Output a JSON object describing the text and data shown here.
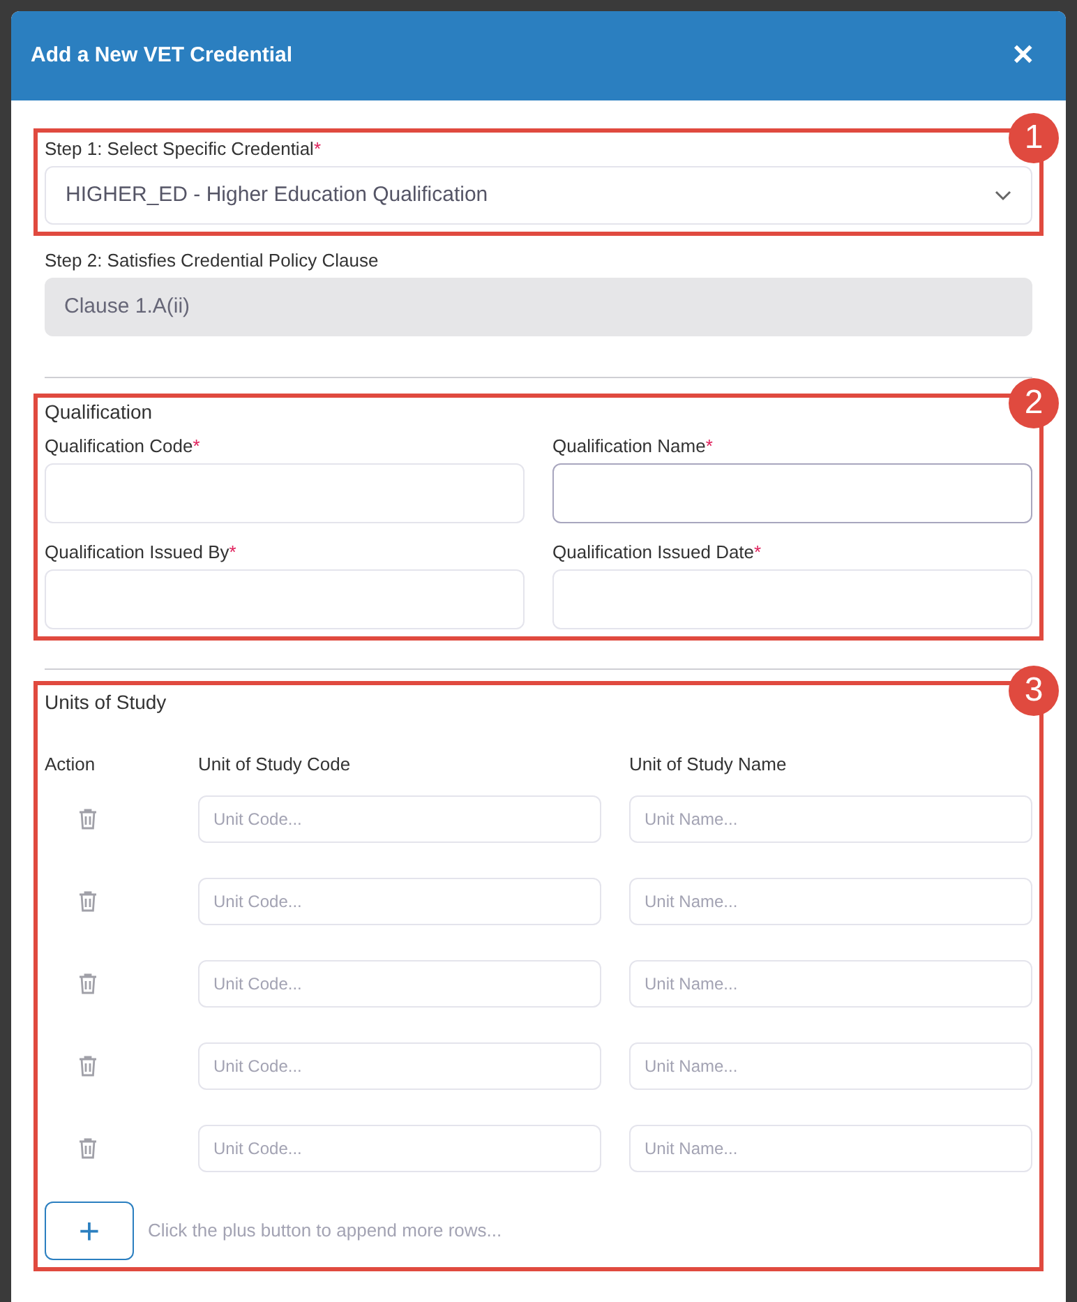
{
  "dialog": {
    "title": "Add a New VET Credential",
    "close": "✕"
  },
  "step1": {
    "annotation": "1",
    "label": "Step 1: Select Specific Credential",
    "required_mark": "*",
    "value": "HIGHER_ED - Higher Education Qualification"
  },
  "step2": {
    "label": "Step 2: Satisfies Credential Policy Clause",
    "value": "Clause 1.A(ii)",
    "disabled": true
  },
  "qualification": {
    "annotation": "2",
    "heading": "Qualification",
    "fields": [
      {
        "label": "Qualification Code",
        "required_mark": "*",
        "focused": false
      },
      {
        "label": "Qualification Name",
        "required_mark": "*",
        "focused": true
      },
      {
        "label": "Qualification Issued By",
        "required_mark": "*",
        "focused": false
      },
      {
        "label": "Qualification Issued Date",
        "required_mark": "*",
        "focused": false
      }
    ]
  },
  "units": {
    "annotation": "3",
    "heading": "Units of Study",
    "columns": [
      "Action",
      "Unit of Study Code",
      "Unit of Study Name"
    ],
    "rows": [
      {
        "code_placeholder": "Unit Code...",
        "name_placeholder": "Unit Name..."
      },
      {
        "code_placeholder": "Unit Code...",
        "name_placeholder": "Unit Name..."
      },
      {
        "code_placeholder": "Unit Code...",
        "name_placeholder": "Unit Name..."
      },
      {
        "code_placeholder": "Unit Code...",
        "name_placeholder": "Unit Name..."
      },
      {
        "code_placeholder": "Unit Code...",
        "name_placeholder": "Unit Name..."
      }
    ],
    "add_button": "+",
    "hint": "Click the plus button to append more rows..."
  }
}
